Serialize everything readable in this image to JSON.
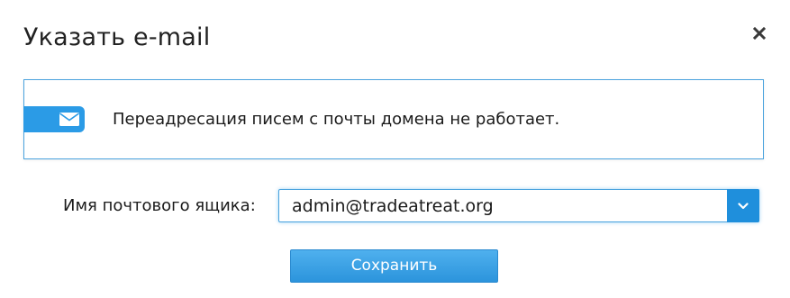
{
  "dialog": {
    "title": "Указать e-mail",
    "close_icon": "close-icon"
  },
  "notice": {
    "icon": "envelope-icon",
    "text": "Переадресация писем с почты домена не работает."
  },
  "mailbox_field": {
    "label": "Имя почтового ящика:",
    "selected_value": "admin@tradeatreat.org",
    "arrow_icon": "chevron-down-icon"
  },
  "actions": {
    "save_label": "Сохранить"
  },
  "colors": {
    "accent": "#2b9be6",
    "border": "#4aa3de",
    "text": "#1a1a1a"
  }
}
